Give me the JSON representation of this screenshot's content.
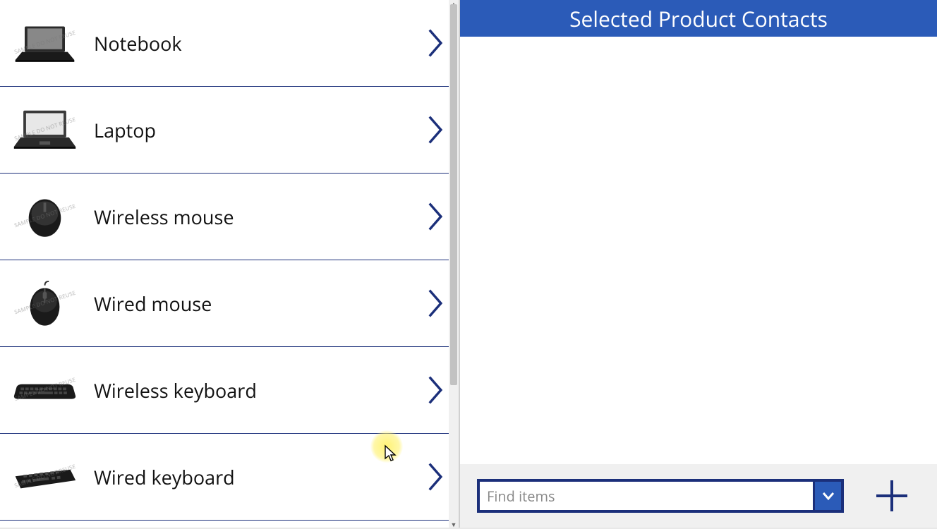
{
  "products": [
    {
      "name": "Notebook",
      "icon": "notebook"
    },
    {
      "name": "Laptop",
      "icon": "laptop"
    },
    {
      "name": "Wireless mouse",
      "icon": "mouse-wireless"
    },
    {
      "name": "Wired mouse",
      "icon": "mouse-wired"
    },
    {
      "name": "Wireless keyboard",
      "icon": "keyboard"
    },
    {
      "name": "Wired keyboard",
      "icon": "keyboard"
    }
  ],
  "right": {
    "header": "Selected Product Contacts",
    "find_placeholder": "Find items"
  },
  "watermark": "SAMPLE\nDO NOT REUSE",
  "colors": {
    "accent": "#2b5bb8",
    "accent_dark": "#1b2f7a"
  }
}
